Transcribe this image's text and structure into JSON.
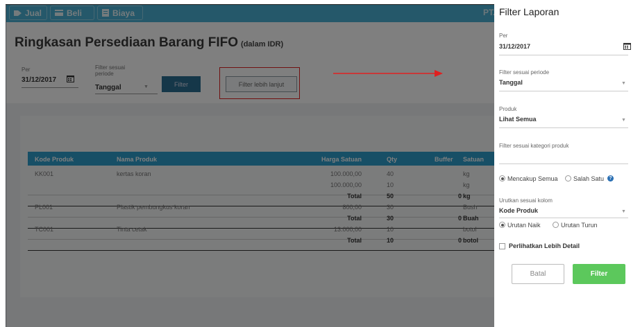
{
  "nav": {
    "items": [
      {
        "label": "Jual",
        "icon": "tag-icon"
      },
      {
        "label": "Beli",
        "icon": "card-icon"
      },
      {
        "label": "Biaya",
        "icon": "doc-icon"
      }
    ],
    "company": "PT. S"
  },
  "page": {
    "title": "Ringkasan Persediaan Barang FIFO",
    "subtitle": "(dalam IDR)"
  },
  "filters": {
    "per_label": "Per",
    "per_value": "31/12/2017",
    "period_label": "Filter sesuai periode",
    "period_value": "Tanggal",
    "filter_button": "Filter",
    "more_button": "Filter lebih lanjut"
  },
  "table": {
    "headers": [
      "Kode Produk",
      "Nama Produk",
      "Harga Satuan",
      "Qty",
      "Buffer",
      "Satuan"
    ],
    "rows": [
      {
        "kode": "KK001",
        "nama": "kertas koran",
        "harga": "100.000,00",
        "qty": "40",
        "buffer": "",
        "satuan": "kg",
        "total": false
      },
      {
        "kode": "",
        "nama": "",
        "harga": "100.000,00",
        "qty": "10",
        "buffer": "",
        "satuan": "kg",
        "total": false
      },
      {
        "kode": "",
        "nama": "",
        "harga": "Total",
        "qty": "50",
        "buffer": "0",
        "satuan": "kg",
        "total": true
      },
      {
        "kode": "PL001",
        "nama": "Plastik pembungkus koran",
        "harga": "800,00",
        "qty": "30",
        "buffer": "",
        "satuan": "Bush",
        "total": false
      },
      {
        "kode": "",
        "nama": "",
        "harga": "Total",
        "qty": "30",
        "buffer": "0",
        "satuan": "Buah",
        "total": true
      },
      {
        "kode": "TC001",
        "nama": "Tinta cetak",
        "harga": "13.000,00",
        "qty": "10",
        "buffer": "",
        "satuan": "botol",
        "total": false
      },
      {
        "kode": "",
        "nama": "",
        "harga": "Total",
        "qty": "10",
        "buffer": "0",
        "satuan": "botol",
        "total": true
      }
    ]
  },
  "panel": {
    "title": "Filter Laporan",
    "per_label": "Per",
    "per_value": "31/12/2017",
    "period_label": "Filter sesuai periode",
    "period_value": "Tanggal",
    "produk_label": "Produk",
    "produk_value": "Lihat Semua",
    "kategori_label": "Filter sesuai kategori produk",
    "match_all": "Mencakup Semua",
    "match_one": "Salah Satu",
    "sort_label": "Urutkan sesuai kolom",
    "sort_value": "Kode Produk",
    "asc": "Urutan Naik",
    "desc": "Urutan Turun",
    "detail": "Perlihatkan Lebih Detail",
    "cancel": "Batal",
    "submit": "Filter"
  },
  "colors": {
    "nav": "#4ab0d4",
    "table_header": "#2f9fcc",
    "filter_button": "#2b6f93",
    "submit": "#5cc85c",
    "highlight": "#e02020"
  }
}
